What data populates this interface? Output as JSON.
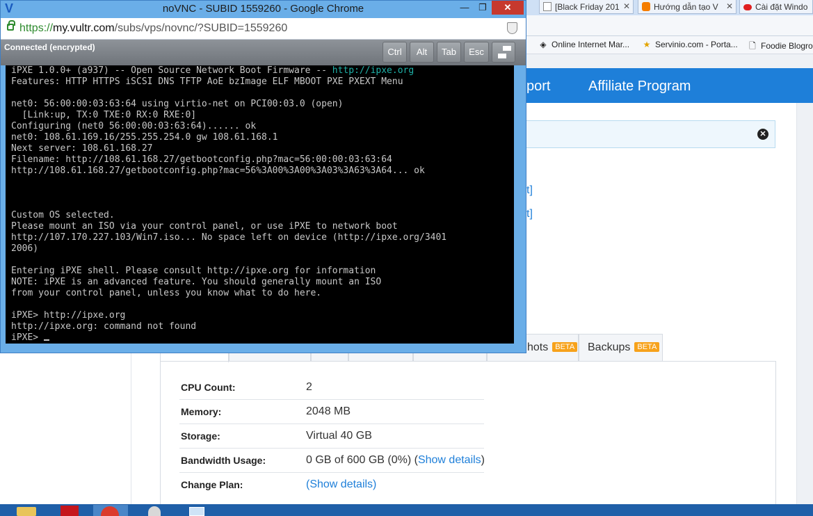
{
  "window": {
    "title": "noVNC - SUBID 1559260 - Google Chrome",
    "url_scheme": "https://",
    "url_host": "my.vultr.com",
    "url_path": "/subs/vps/novnc/?SUBID=1559260",
    "min_glyph": "—",
    "max_glyph": "❐",
    "close_glyph": "✕"
  },
  "vnc": {
    "status": "Connected (encrypted)",
    "keys": [
      "Ctrl",
      "Alt",
      "Tab",
      "Esc"
    ]
  },
  "terminal": {
    "lines": [
      "iPXE 1.0.0+ (a937) -- Open Source Network Boot Firmware -- ",
      "Features: HTTP HTTPS iSCSI DNS TFTP AoE bzImage ELF MBOOT PXE PXEXT Menu",
      "",
      "net0: 56:00:00:03:63:64 using virtio-net on PCI00:03.0 (open)",
      "  [Link:up, TX:0 TXE:0 RX:0 RXE:0]",
      "Configuring (net0 56:00:00:03:63:64)...... ok",
      "net0: 108.61.169.16/255.255.254.0 gw 108.61.168.1",
      "Next server: 108.61.168.27",
      "Filename: http://108.61.168.27/getbootconfig.php?mac=56:00:00:03:63:64",
      "http://108.61.168.27/getbootconfig.php?mac=56%3A00%3A00%3A03%3A63%3A64... ok",
      "",
      "",
      "",
      "Custom OS selected.",
      "Please mount an ISO via your control panel, or use iPXE to network boot",
      "http://107.170.227.103/Win7.iso... No space left on device (http://ipxe.org/3401",
      "2006)",
      "",
      "Entering iPXE shell. Please consult http://ipxe.org for information",
      "NOTE: iPXE is an advanced feature. You should generally mount an ISO",
      "from your control panel, unless you know what to do here.",
      "",
      "iPXE> http://ipxe.org",
      "http://ipxe.org: command not found",
      "iPXE> "
    ],
    "header_link": "http://ipxe.org"
  },
  "bg_tabs": [
    {
      "label": "[Black Friday 201"
    },
    {
      "label": "Hướng dẫn tạo V"
    },
    {
      "label": "Cài đặt Windo"
    }
  ],
  "bookmarks": [
    {
      "label": "Online Internet Mar...",
      "icon": "◈"
    },
    {
      "label": "Servinio.com - Porta...",
      "icon": "★"
    },
    {
      "label": "Foodie Blogro",
      "icon": "🗋"
    }
  ],
  "nav": {
    "items": [
      "port",
      "Affiliate Program"
    ]
  },
  "alert_close": "✕",
  "frag_links": [
    "t]",
    "t]"
  ],
  "tabs": [
    {
      "label": "hots",
      "beta": "BETA"
    },
    {
      "label": "Backups",
      "beta": "BETA"
    }
  ],
  "specs": [
    {
      "label": "CPU Count:",
      "value": "2"
    },
    {
      "label": "Memory:",
      "value": "2048 MB"
    },
    {
      "label": "Storage:",
      "value": "Virtual 40 GB"
    },
    {
      "label": "Bandwidth Usage:",
      "value": "0 GB of 600 GB (0%) (",
      "link": "Show details",
      "suffix": ")"
    },
    {
      "label": "Change Plan:",
      "value": "(",
      "link": "Show details",
      "suffix": ")"
    }
  ],
  "colors": {
    "accent": "#1e7fd9",
    "beta": "#f7a21b",
    "terminal_link": "#1fb1a8"
  }
}
